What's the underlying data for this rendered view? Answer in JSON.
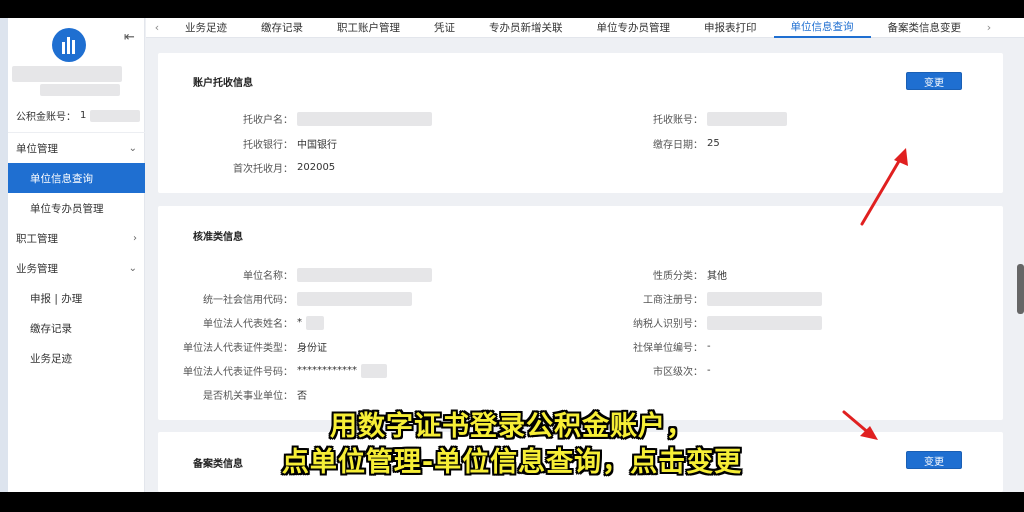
{
  "sidebar": {
    "account_label": "公积金账号：",
    "account_value": "1",
    "menu": [
      {
        "label": "单位管理",
        "type": "group",
        "chevron": "down"
      },
      {
        "label": "单位信息查询",
        "type": "sub",
        "active": true
      },
      {
        "label": "单位专办员管理",
        "type": "sub"
      },
      {
        "label": "职工管理",
        "type": "group",
        "chevron": "right"
      },
      {
        "label": "业务管理",
        "type": "group",
        "chevron": "down"
      },
      {
        "label": "申报 | 办理",
        "type": "sub"
      },
      {
        "label": "缴存记录",
        "type": "sub"
      },
      {
        "label": "业务足迹",
        "type": "sub"
      }
    ]
  },
  "tabs": [
    "业务足迹",
    "缴存记录",
    "职工账户管理",
    "凭证",
    "专办员新增关联",
    "单位专办员管理",
    "申报表打印",
    "单位信息查询",
    "备案类信息变更"
  ],
  "active_tab": 7,
  "card1": {
    "title": "账户托收信息",
    "button": "变更",
    "fields": {
      "payer_name": "托收户名：",
      "account_no": "托收账号：",
      "bank": "托收银行：",
      "bank_value": "中国银行",
      "deposit_day": "缴存日期：",
      "deposit_day_value": "25",
      "first_month": "首次托收月：",
      "first_month_value": "202005"
    }
  },
  "card2": {
    "title": "核准类信息",
    "fields": {
      "unit_name": "单位名称：",
      "nature": "性质分类：",
      "nature_value": "其他",
      "credit_code": "统一社会信用代码：",
      "biz_reg": "工商注册号：",
      "legal_name": "单位法人代表姓名：",
      "legal_name_value": "*",
      "taxpayer": "纳税人识别号：",
      "id_type": "单位法人代表证件类型：",
      "id_type_value": "身份证",
      "social_no": "社保单位编号：",
      "social_no_value": "-",
      "id_no": "单位法人代表证件号码：",
      "id_no_value": "************",
      "district": "市区级次：",
      "district_value": "-",
      "govt": "是否机关事业单位：",
      "govt_value": "否"
    }
  },
  "card3": {
    "title": "备案类信息",
    "button": "变更"
  },
  "subtitles": {
    "line1": "用数字证书登录公积金账户，",
    "line2": "点单位管理-单位信息查询，点击变更"
  },
  "colors": {
    "accent": "#1f6fd1",
    "arrow": "#e02020",
    "subtitle": "#f6ee36"
  }
}
